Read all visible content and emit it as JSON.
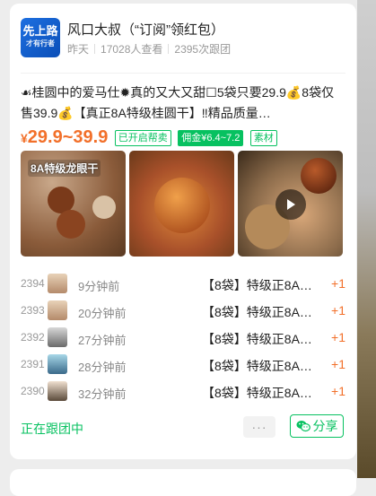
{
  "header": {
    "avatar_line1": "先上路",
    "avatar_line2": "才有行者",
    "title": "风口大叔（“订阅”领红包）",
    "date": "昨天",
    "views": "17028人查看",
    "orders": "2395次跟团"
  },
  "product": {
    "description": "☙桂圆中的爱马仕✹真的又大又甜☐5袋只要29.9💰8袋仅售39.9💰【真正8A特级桂圆干】‼精品质量…",
    "price_symbol": "¥",
    "price_range": "29.9~39.9",
    "tags": [
      "已开启帮卖",
      "佣金¥6.4~7.2",
      "素材"
    ],
    "image1_label": "8A特级龙眼干"
  },
  "orders_list": [
    {
      "num": "2394",
      "time": "9分钟前",
      "item": "【8袋】特级正8A…",
      "qty": "+1"
    },
    {
      "num": "2393",
      "time": "20分钟前",
      "item": "【8袋】特级正8A…",
      "qty": "+1"
    },
    {
      "num": "2392",
      "time": "27分钟前",
      "item": "【8袋】特级正8A…",
      "qty": "+1"
    },
    {
      "num": "2391",
      "time": "28分钟前",
      "item": "【8袋】特级正8A…",
      "qty": "+1"
    },
    {
      "num": "2390",
      "time": "32分钟前",
      "item": "【8袋】特级正8A…",
      "qty": "+1"
    }
  ],
  "footer": {
    "status": "正在跟团中",
    "more": "···",
    "share": "分享"
  },
  "colors": {
    "accent_green": "#07c160",
    "price_orange": "#f2702a"
  }
}
